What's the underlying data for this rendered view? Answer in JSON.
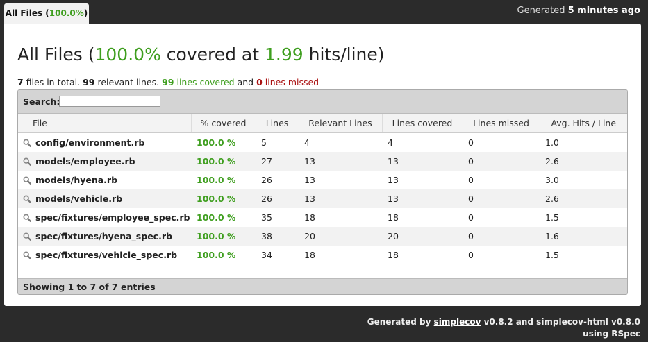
{
  "tab": {
    "label": "All Files",
    "percent": "100.0%"
  },
  "generated": {
    "prefix": "Generated",
    "when": "5 minutes ago"
  },
  "heading": {
    "prefix": "All Files (",
    "percent": "100.0%",
    "middle": " covered at ",
    "hits": "1.99",
    "suffix": " hits/line)"
  },
  "summary": {
    "files": "7",
    "files_text": " files in total. ",
    "relevant": "99",
    "relevant_text": " relevant lines. ",
    "covered": "99",
    "covered_text": " lines covered",
    "and_text": " and ",
    "missed": "0",
    "missed_text": " lines missed"
  },
  "search": {
    "label": "Search:",
    "value": ""
  },
  "columns": [
    "File",
    "% covered",
    "Lines",
    "Relevant Lines",
    "Lines covered",
    "Lines missed",
    "Avg. Hits / Line"
  ],
  "rows": [
    {
      "file": "config/environment.rb",
      "covered_pct": "100.0 %",
      "lines": "5",
      "relevant": "4",
      "covered": "4",
      "missed": "0",
      "avg": "1.0"
    },
    {
      "file": "models/employee.rb",
      "covered_pct": "100.0 %",
      "lines": "27",
      "relevant": "13",
      "covered": "13",
      "missed": "0",
      "avg": "2.6"
    },
    {
      "file": "models/hyena.rb",
      "covered_pct": "100.0 %",
      "lines": "26",
      "relevant": "13",
      "covered": "13",
      "missed": "0",
      "avg": "3.0"
    },
    {
      "file": "models/vehicle.rb",
      "covered_pct": "100.0 %",
      "lines": "26",
      "relevant": "13",
      "covered": "13",
      "missed": "0",
      "avg": "2.6"
    },
    {
      "file": "spec/fixtures/employee_spec.rb",
      "covered_pct": "100.0 %",
      "lines": "35",
      "relevant": "18",
      "covered": "18",
      "missed": "0",
      "avg": "1.5"
    },
    {
      "file": "spec/fixtures/hyena_spec.rb",
      "covered_pct": "100.0 %",
      "lines": "38",
      "relevant": "20",
      "covered": "20",
      "missed": "0",
      "avg": "1.6"
    },
    {
      "file": "spec/fixtures/vehicle_spec.rb",
      "covered_pct": "100.0 %",
      "lines": "34",
      "relevant": "18",
      "covered": "18",
      "missed": "0",
      "avg": "1.5"
    }
  ],
  "table_footer": "Showing 1 to 7 of 7 entries",
  "credits": {
    "line1_prefix": "Generated by ",
    "link": "simplecov",
    "line1_suffix": " v0.8.2 and simplecov-html v0.8.0",
    "line2": "using RSpec"
  },
  "colors": {
    "green": "#3e9e1e",
    "red": "#aa1111",
    "background": "#2b2b2b"
  },
  "icons": {
    "row_icon": "magnifier-icon"
  }
}
